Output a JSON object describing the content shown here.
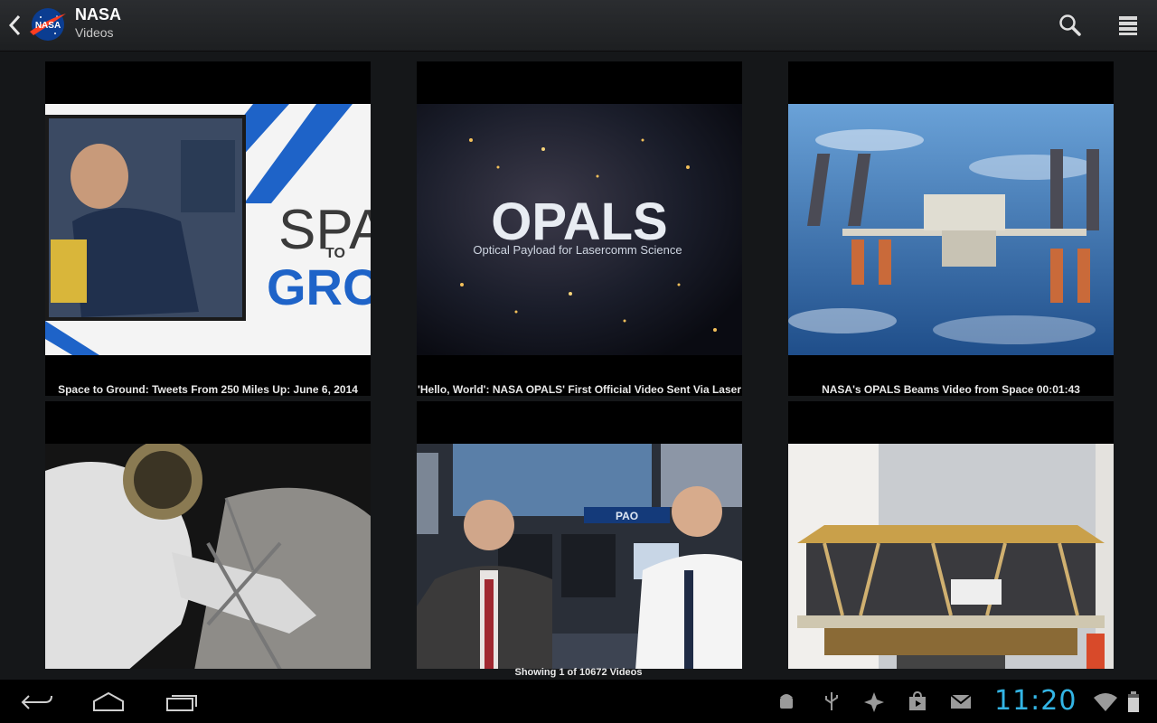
{
  "header": {
    "title": "NASA",
    "subtitle": "Videos",
    "actions": [
      "search-icon",
      "menu-icon"
    ]
  },
  "videos": [
    {
      "title": "Space to Ground: Tweets From 250 Miles Up: June 6, 2014",
      "thumb_text": [
        "SPAC",
        "TO",
        "GROUN"
      ]
    },
    {
      "title": "'Hello, World': NASA OPALS' First Official Video Sent Via Laser",
      "thumb_text": [
        "OPALS",
        "Optical Payload for Lasercomm Science"
      ]
    },
    {
      "title": "NASA's OPALS Beams Video from Space 00:01:43"
    },
    {
      "title": ""
    },
    {
      "title": "",
      "thumb_text": [
        "PAO"
      ]
    },
    {
      "title": ""
    }
  ],
  "footer": {
    "status": "Showing 1 of 10672 Videos"
  },
  "system_bar": {
    "clock": "11:20",
    "nav": [
      "back-icon",
      "home-icon",
      "recent-apps-icon"
    ],
    "notifications": [
      "android-debug-icon",
      "usb-icon",
      "sync-icon",
      "store-icon",
      "mail-icon"
    ],
    "accent": "#33b5e5"
  }
}
